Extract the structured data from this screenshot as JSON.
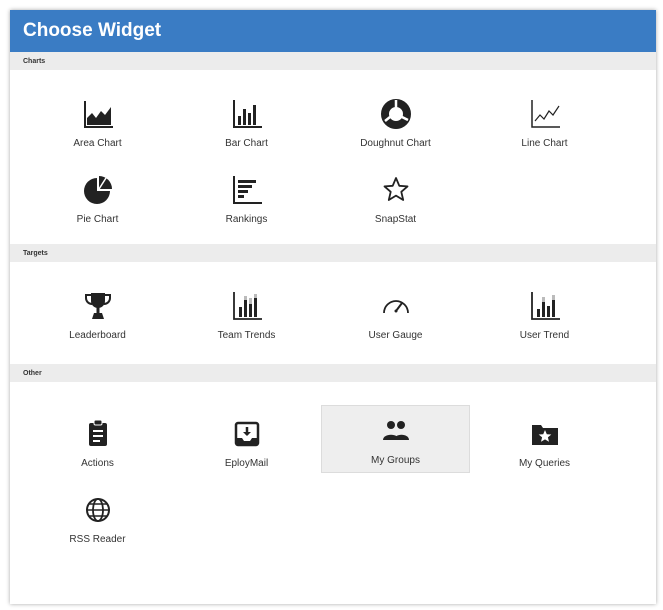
{
  "dialog": {
    "title": "Choose Widget"
  },
  "sections": {
    "charts": {
      "label": "Charts",
      "items": [
        {
          "label": "Area Chart",
          "icon": "area-chart-icon"
        },
        {
          "label": "Bar Chart",
          "icon": "bar-chart-icon"
        },
        {
          "label": "Doughnut Chart",
          "icon": "doughnut-chart-icon"
        },
        {
          "label": "Line Chart",
          "icon": "line-chart-icon"
        },
        {
          "label": "Pie Chart",
          "icon": "pie-chart-icon"
        },
        {
          "label": "Rankings",
          "icon": "rankings-icon"
        },
        {
          "label": "SnapStat",
          "icon": "star-outline-icon"
        }
      ]
    },
    "targets": {
      "label": "Targets",
      "items": [
        {
          "label": "Leaderboard",
          "icon": "trophy-icon"
        },
        {
          "label": "Team Trends",
          "icon": "team-trends-icon"
        },
        {
          "label": "User Gauge",
          "icon": "gauge-icon"
        },
        {
          "label": "User Trend",
          "icon": "user-trend-icon"
        }
      ]
    },
    "other": {
      "label": "Other",
      "items": [
        {
          "label": "Actions",
          "icon": "clipboard-icon"
        },
        {
          "label": "EployMail",
          "icon": "inbox-download-icon"
        },
        {
          "label": "My Groups",
          "icon": "groups-icon",
          "selected": true
        },
        {
          "label": "My Queries",
          "icon": "star-folder-icon"
        },
        {
          "label": "RSS Reader",
          "icon": "globe-icon"
        }
      ]
    }
  },
  "colors": {
    "header": "#3a7cc4",
    "icon": "#222222",
    "section_band": "#ececec"
  }
}
